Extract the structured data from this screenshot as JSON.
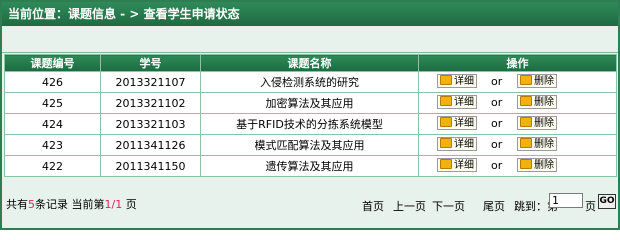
{
  "breadcrumb": "当前位置：课题信息 - > 查看学生申请状态",
  "table": {
    "headers": [
      "课题编号",
      "学号",
      "课题名称",
      "操作"
    ],
    "rows": [
      {
        "id": "426",
        "student_no": "2013321107",
        "title": "入侵检测系统的研究"
      },
      {
        "id": "425",
        "student_no": "2013321102",
        "title": "加密算法及其应用"
      },
      {
        "id": "424",
        "student_no": "2013321103",
        "title": "基于RFID技术的分拣系统模型"
      },
      {
        "id": "423",
        "student_no": "2011341126",
        "title": "模式匹配算法及其应用"
      },
      {
        "id": "422",
        "student_no": "2011341150",
        "title": "遗传算法及其应用"
      }
    ],
    "detail_label": "详细",
    "delete_label": "删除",
    "or_label": "or"
  },
  "footer": {
    "total_prefix": "共有",
    "total_count": "5",
    "total_mid": "条记录  当前第",
    "current_page": "1",
    "slash": "/",
    "total_pages": "1",
    "page_suffix": " 页"
  },
  "pager": {
    "first": "首页",
    "prev": "上一页",
    "next": "下一页",
    "last": "尾页",
    "jump_label": "跳到：第",
    "jump_value": "1",
    "jump_suffix": "页",
    "go": "GO"
  },
  "colors": {
    "header_green": "#1f6b42",
    "background": "#e7f2ec",
    "highlight_red": "#e0245e"
  }
}
